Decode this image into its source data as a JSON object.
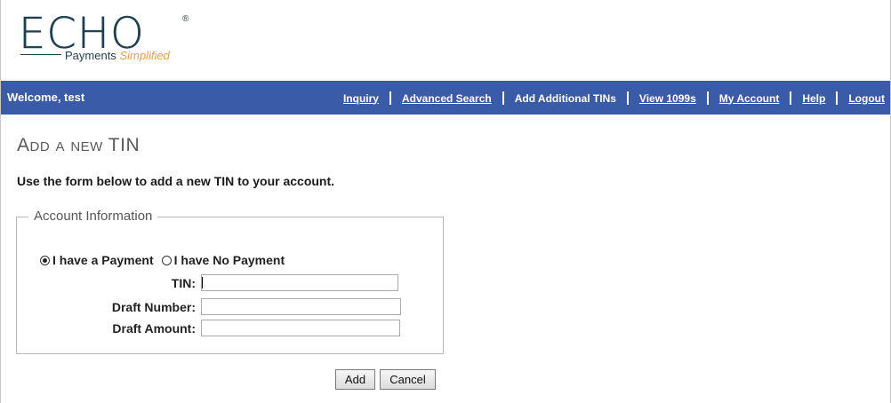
{
  "logo": {
    "word": "ECHO",
    "registered": "®",
    "tagline_prefix": "Payments",
    "tagline_highlight": "Simplified"
  },
  "nav": {
    "welcome": "Welcome, test",
    "links": [
      {
        "label": "Inquiry",
        "type": "link"
      },
      {
        "label": "Advanced Search",
        "type": "link"
      },
      {
        "label": "Add Additional TINs",
        "type": "current"
      },
      {
        "label": "View 1099s",
        "type": "link"
      },
      {
        "label": "My Account",
        "type": "link"
      },
      {
        "label": "Help",
        "type": "link"
      },
      {
        "label": "Logout",
        "type": "link"
      }
    ]
  },
  "page": {
    "title": "Add a new TIN",
    "intro": "Use the form below to add a new TIN to your account."
  },
  "form": {
    "legend": "Account Information",
    "radio_payment": "I have a Payment",
    "radio_no_payment": "I have No Payment",
    "selected_option": "I have a Payment",
    "tin_label": "TIN:",
    "tin_value": "",
    "draft_number_label": "Draft Number:",
    "draft_number_value": "",
    "draft_amount_label": "Draft Amount:",
    "draft_amount_value": ""
  },
  "buttons": {
    "add": "Add",
    "cancel": "Cancel"
  },
  "colors": {
    "nav_bg": "#3a5ba8",
    "logo_dark": "#1c3f52",
    "logo_accent": "#e8a33b"
  }
}
